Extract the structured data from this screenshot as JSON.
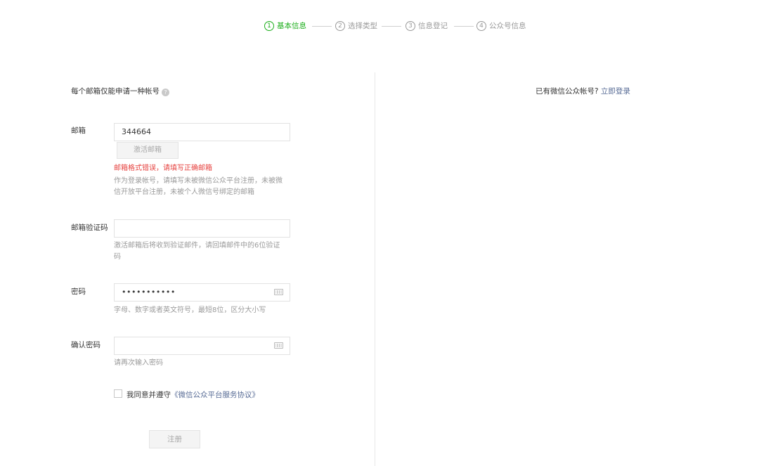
{
  "steps": [
    {
      "num": "1",
      "label": "基本信息",
      "active": true
    },
    {
      "num": "2",
      "label": "选择类型",
      "active": false
    },
    {
      "num": "3",
      "label": "信息登记",
      "active": false
    },
    {
      "num": "4",
      "label": "公众号信息",
      "active": false
    }
  ],
  "intro": {
    "text": "每个邮箱仅能申请一种帐号",
    "help_icon": "?"
  },
  "login_hint": {
    "text": "已有微信公众帐号?",
    "link": "立即登录"
  },
  "form": {
    "email": {
      "label": "邮箱",
      "value": "344664",
      "activate_button": "激活邮箱",
      "error": "邮箱格式错误，请填写正确邮箱",
      "tip": "作为登录帐号，请填写未被微信公众平台注册，未被微信开放平台注册，未被个人微信号绑定的邮箱"
    },
    "verify_code": {
      "label": "邮箱验证码",
      "value": "",
      "tip": "激活邮箱后将收到验证邮件，请回填邮件中的6位验证码"
    },
    "password": {
      "label": "密码",
      "value": "•••••••••••",
      "tip": "字母、数字或者英文符号，最短8位，区分大小写"
    },
    "confirm_password": {
      "label": "确认密码",
      "value": "",
      "tip": "请再次输入密码"
    },
    "agree": {
      "text": "我同意并遵守",
      "link": "《微信公众平台服务协议》"
    },
    "register_button": "注册"
  },
  "colors": {
    "accent": "#1aad19",
    "link": "#576b95",
    "error": "#e64340"
  }
}
